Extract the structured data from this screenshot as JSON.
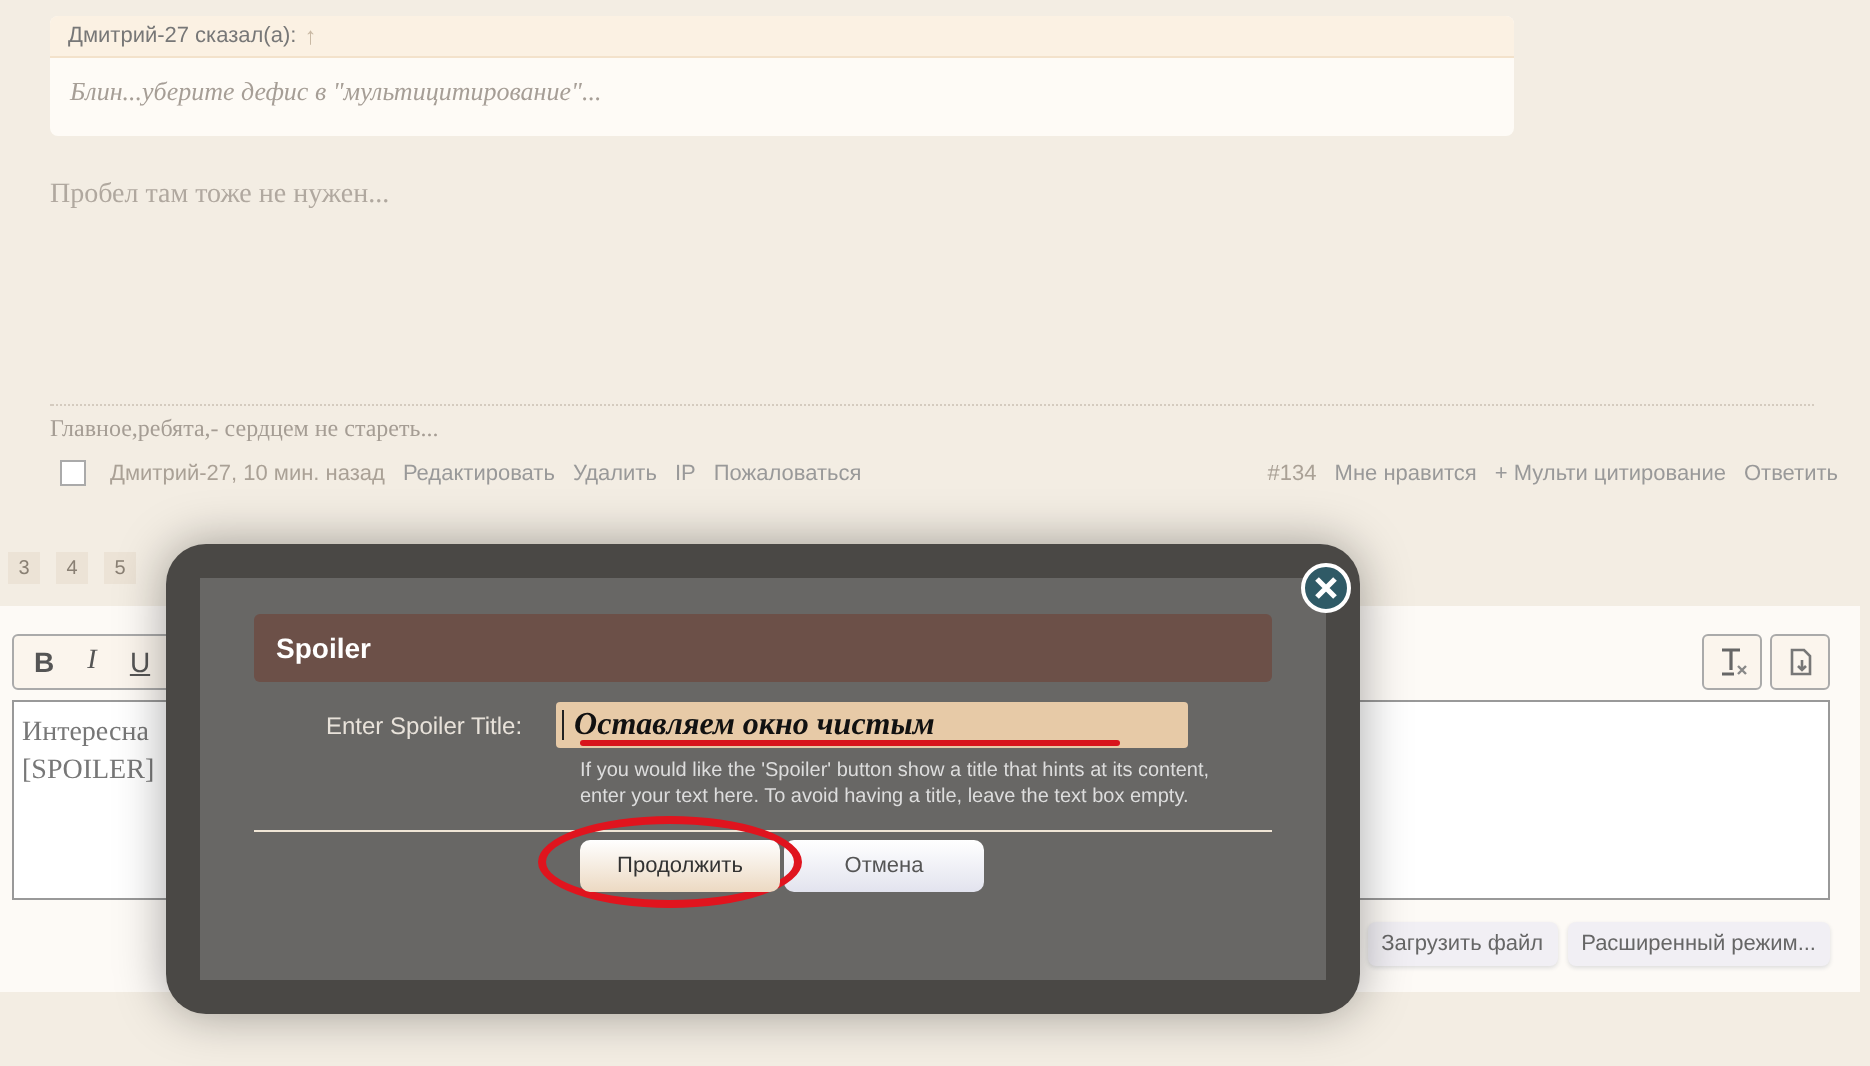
{
  "quote": {
    "author": "Дмитрий-27 сказал(а):",
    "jump": "↑",
    "text": "Блин...уберите дефис в \"мультицитирование\"..."
  },
  "post": {
    "text": "Пробел там тоже не нужен...",
    "signature": "Главное,ребята,- сердцем не стареть...",
    "selected": false,
    "author_time": "Дмитрий-27, 10 мин. назад",
    "actions": [
      "Редактировать",
      "Удалить",
      "IP",
      "Пожаловаться"
    ],
    "number": "#134",
    "right_actions": [
      "Мне нравится",
      "+ Мульти цитирование",
      "Ответить"
    ]
  },
  "pagination": [
    {
      "label": "3"
    },
    {
      "label": "4"
    },
    {
      "label": "5"
    }
  ],
  "editor": {
    "toolbar": [
      {
        "label": "B",
        "kind": "bold"
      },
      {
        "label": "I",
        "kind": "italic"
      },
      {
        "label": "U",
        "kind": "underline"
      }
    ],
    "lines": [
      "Интересна",
      "[SPOILER]"
    ],
    "buttons": [
      "Загрузить файл",
      "Расширенный режим..."
    ]
  },
  "dialog": {
    "title": "Spoiler",
    "label": "Enter Spoiler Title:",
    "value": "Оставляем окно чистым",
    "hint": "If you would like the 'Spoiler' button show a title that hints at its content, enter your text here. To avoid having a title, leave the text box empty.",
    "buttons": [
      {
        "label": "Продолжить",
        "kind": "primary"
      },
      {
        "label": "Отмена",
        "kind": "secondary"
      }
    ]
  }
}
